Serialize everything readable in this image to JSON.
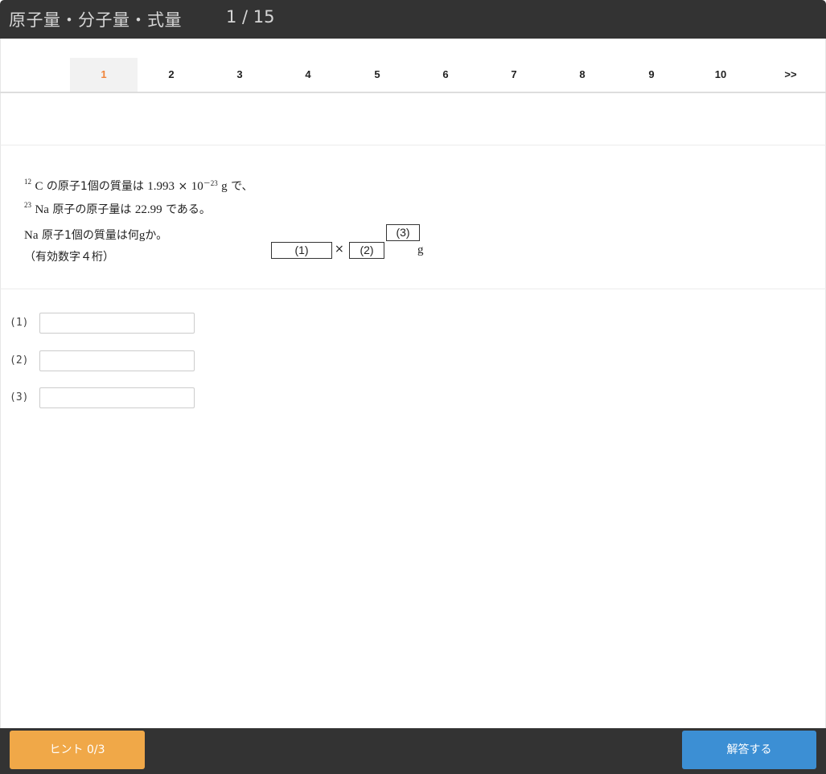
{
  "header": {
    "title": "原子量・分子量・式量",
    "counter": "1 / 15"
  },
  "pager": {
    "items": [
      "1",
      "2",
      "3",
      "4",
      "5",
      "6",
      "7",
      "8",
      "9",
      "10"
    ],
    "next_label": ">>",
    "active": "1"
  },
  "question": {
    "line1": {
      "sup": "12",
      "part1": "C",
      "part2": "の原子1個の質量は",
      "val": "1.993",
      "times": "×",
      "base": "10",
      "exp": "－23",
      "unit": "g",
      "tail": "で、"
    },
    "line2": {
      "sup": "23",
      "elem": "Na",
      "part2": "原子の原子量は",
      "val": "22.99",
      "tail": "である。"
    },
    "line3": {
      "elem": "Na",
      "part2": "原子1個の質量は何",
      "unit": "g",
      "tail": "か。"
    },
    "line4": "（有効数字４桁）",
    "formula": {
      "box1": "(1)",
      "times": "×",
      "box2": "(2)",
      "box3": "(3)",
      "unit": "g"
    }
  },
  "answers": [
    {
      "label": "(1)",
      "value": ""
    },
    {
      "label": "(2)",
      "value": ""
    },
    {
      "label": "(3)",
      "value": ""
    }
  ],
  "footer": {
    "hint_label": "ヒント 0/3",
    "answer_label": "解答する"
  },
  "colors": {
    "header_bg": "#333333",
    "active_page": "#f0843a",
    "hint_button": "#f0a848",
    "answer_button": "#3c8fd4"
  }
}
